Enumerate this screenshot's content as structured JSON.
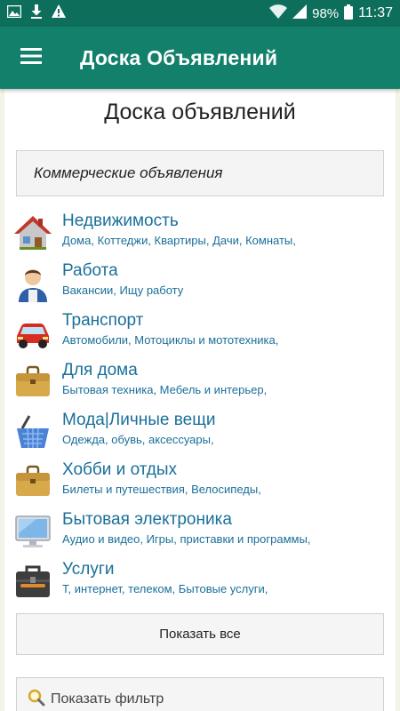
{
  "status_bar": {
    "battery": "98%",
    "time": "11:37",
    "icons": [
      "image-icon",
      "download-icon",
      "warning-icon",
      "wifi-icon",
      "signal-icon",
      "battery-icon"
    ]
  },
  "app_bar": {
    "title": "Доска Объявлений",
    "menu_icon": "hamburger-menu-icon"
  },
  "page": {
    "title": "Доска объявлений",
    "commercial": "Коммерческие объявления",
    "categories": [
      {
        "name": "Недвижимость",
        "sub": "Дома, Коттеджи, Квартиры, Дачи, Комнаты,",
        "icon": "house-icon"
      },
      {
        "name": "Работа",
        "sub": "Вакансии, Ищу работу",
        "icon": "worker-icon"
      },
      {
        "name": "Транспорт",
        "sub": "Автомобили, Мотоциклы и мототехника,",
        "icon": "car-icon"
      },
      {
        "name": "Для дома",
        "sub": "Бытовая техника, Мебель и интерьер,",
        "icon": "briefcase-icon"
      },
      {
        "name": "Мода|Личные вещи",
        "sub": "Одежда, обувь, аксессуары,",
        "icon": "basket-icon"
      },
      {
        "name": "Хобби и отдых",
        "sub": "Билеты и путешествия, Велосипеды,",
        "icon": "briefcase-icon"
      },
      {
        "name": "Бытовая электроника",
        "sub": "Аудио и видео, Игры, приставки и программы,",
        "icon": "monitor-icon"
      },
      {
        "name": "Услуги",
        "sub": "Т, интернет, телеком, Бытовые услуги,",
        "icon": "toolbox-icon"
      }
    ],
    "show_all": "Показать все",
    "show_filter": "Показать фильтр"
  },
  "colors": {
    "status_bar": "#0e6e5c",
    "app_bar": "#12806b",
    "link": "#1a6f9a",
    "background": "#f4f3e9"
  }
}
